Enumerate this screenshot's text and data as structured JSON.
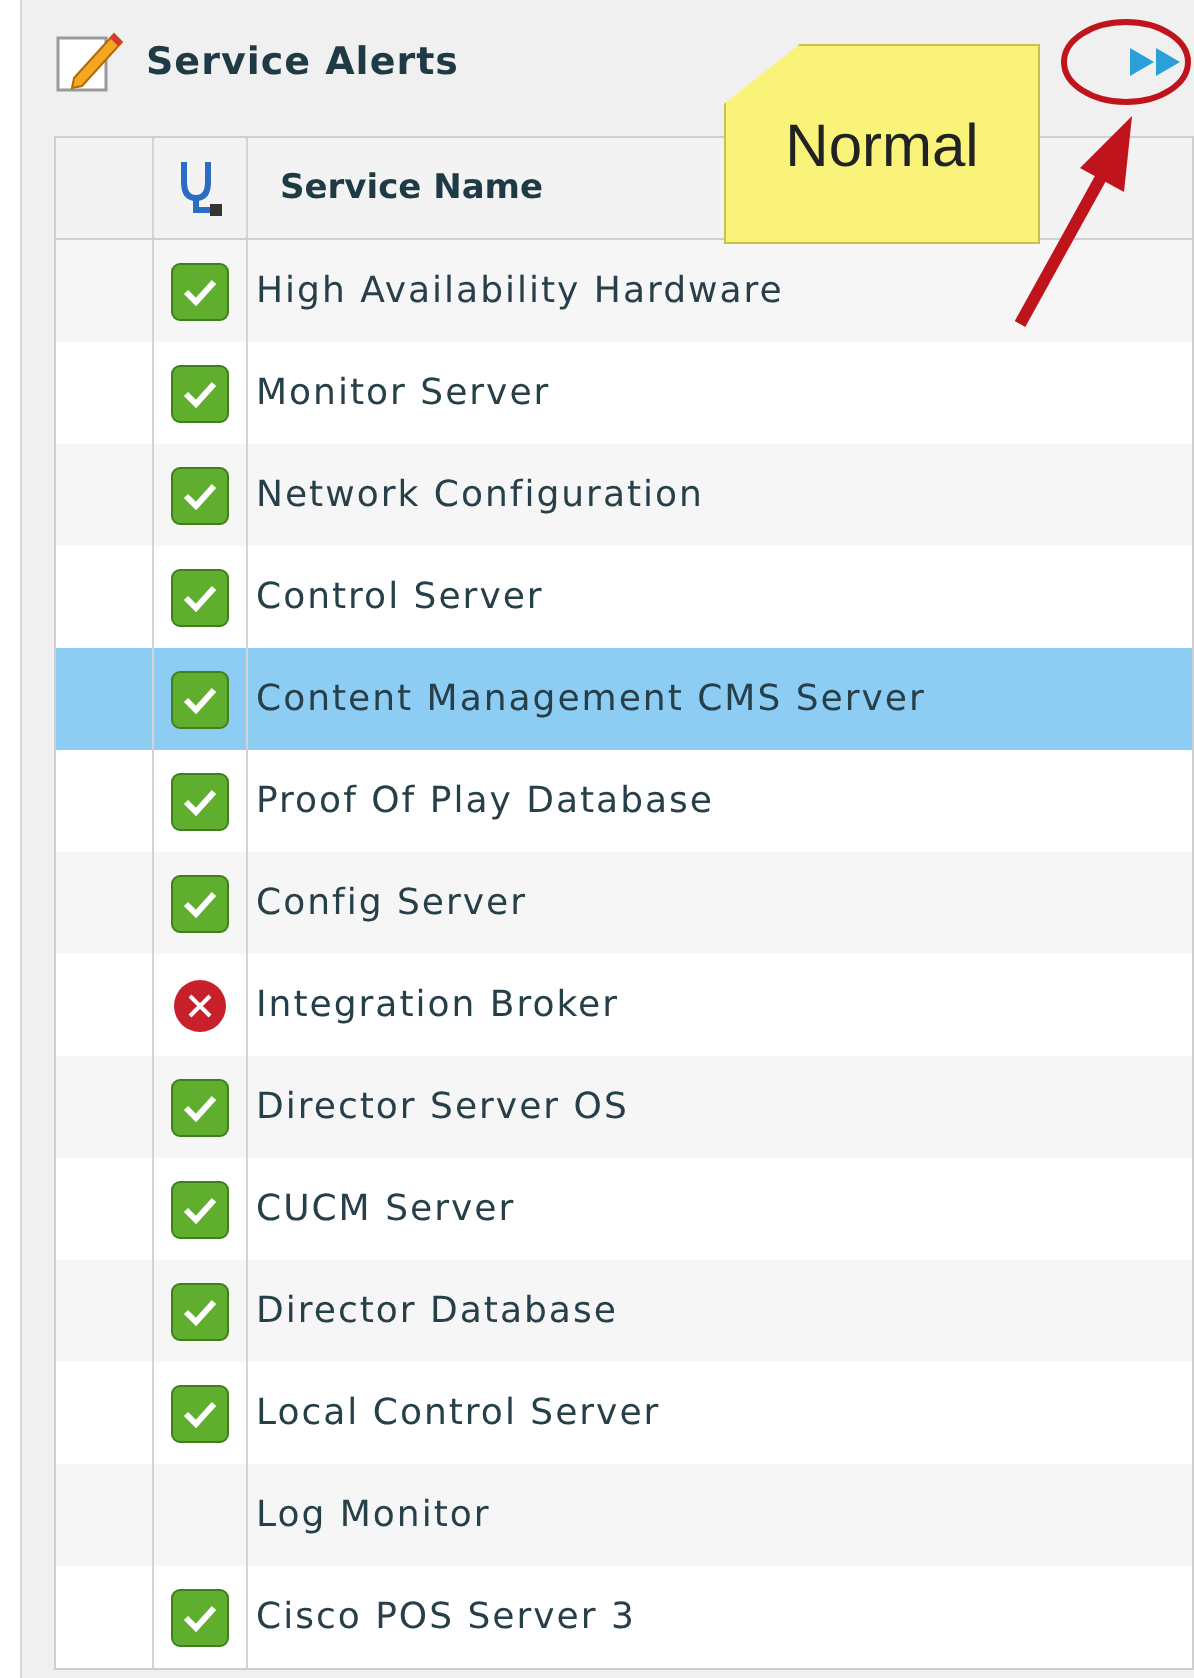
{
  "panel": {
    "title": "Service Alerts"
  },
  "callout": {
    "text": "Normal"
  },
  "table": {
    "columns": [
      "Service Name"
    ],
    "rows": [
      {
        "name": "High Availability Hardware",
        "kind": "ok",
        "selected": false
      },
      {
        "name": "Monitor Server",
        "kind": "ok",
        "selected": false
      },
      {
        "name": "Network Configuration",
        "kind": "ok",
        "selected": false
      },
      {
        "name": "Control Server",
        "kind": "ok",
        "selected": false
      },
      {
        "name": "Content Management CMS Server",
        "kind": "ok",
        "selected": true
      },
      {
        "name": "Proof Of Play Database",
        "kind": "ok",
        "selected": false
      },
      {
        "name": "Config Server",
        "kind": "ok",
        "selected": false
      },
      {
        "name": "Integration Broker",
        "kind": "error",
        "selected": false
      },
      {
        "name": "Director Server OS",
        "kind": "ok",
        "selected": false
      },
      {
        "name": "CUCM Server",
        "kind": "ok",
        "selected": false
      },
      {
        "name": "Director Database",
        "kind": "ok",
        "selected": false
      },
      {
        "name": "Local Control Server",
        "kind": "ok",
        "selected": false
      },
      {
        "name": "Log Monitor",
        "kind": "none",
        "selected": false
      },
      {
        "name": "Cisco POS Server 3",
        "kind": "ok",
        "selected": false
      }
    ]
  }
}
